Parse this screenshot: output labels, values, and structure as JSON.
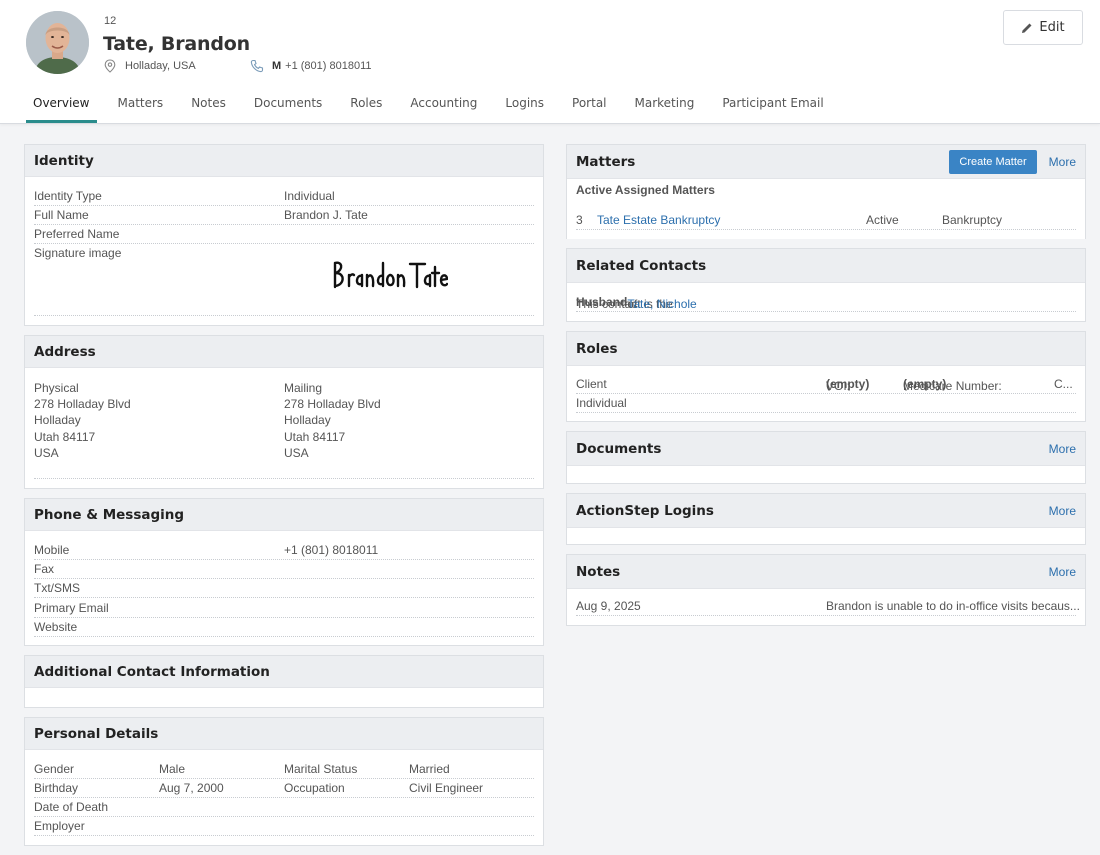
{
  "header": {
    "contact_id": "12",
    "name": "Tate, Brandon",
    "location": "Holladay, USA",
    "phone_type": "M",
    "phone": "+1 (801) 8018011",
    "edit_label": "Edit"
  },
  "tabs": [
    "Overview",
    "Matters",
    "Notes",
    "Documents",
    "Roles",
    "Accounting",
    "Logins",
    "Portal",
    "Marketing",
    "Participant Email"
  ],
  "identity": {
    "title": "Identity",
    "rows": [
      {
        "label": "Identity Type",
        "value": "Individual"
      },
      {
        "label": "Full Name",
        "value": "Brandon J. Tate"
      },
      {
        "label": "Preferred Name",
        "value": ""
      },
      {
        "label": "Signature image",
        "value": ""
      }
    ],
    "signature_text": "Brandon Tate"
  },
  "address": {
    "title": "Address",
    "physical": [
      "Physical",
      "278 Holladay Blvd",
      "Holladay",
      "Utah 84117",
      "USA"
    ],
    "mailing": [
      "Mailing",
      "278 Holladay Blvd",
      "Holladay",
      "Utah 84117",
      "USA"
    ]
  },
  "phone_messaging": {
    "title": "Phone & Messaging",
    "rows": [
      {
        "label": "Mobile",
        "value": "+1 (801) 8018011"
      },
      {
        "label": "Fax",
        "value": ""
      },
      {
        "label": "Txt/SMS",
        "value": ""
      },
      {
        "label": "Primary Email",
        "value": ""
      },
      {
        "label": "Website",
        "value": ""
      }
    ]
  },
  "additional": {
    "title": "Additional Contact Information"
  },
  "personal": {
    "title": "Personal Details",
    "rows": [
      {
        "l1": "Gender",
        "v1": "Male",
        "l2": "Marital Status",
        "v2": "Married"
      },
      {
        "l1": "Birthday",
        "v1": "Aug 7, 2000",
        "l2": "Occupation",
        "v2": "Civil Engineer"
      },
      {
        "l1": "Date of Death",
        "v1": "",
        "l2": "",
        "v2": ""
      },
      {
        "l1": "Employer",
        "v1": "",
        "l2": "",
        "v2": ""
      }
    ]
  },
  "matters": {
    "title": "Matters",
    "create_label": "Create Matter",
    "more_label": "More",
    "subheader": "Active Assigned Matters",
    "items": [
      {
        "id": "3",
        "name": "Tate Estate Bankruptcy",
        "status": "Active",
        "type": "Bankruptcy"
      }
    ]
  },
  "related": {
    "title": "Related Contacts",
    "prefix": "This contact is the",
    "relation": "Husband",
    "of": "of",
    "contact": "Tate, Nichole"
  },
  "roles": {
    "title": "Roles",
    "role": "Client",
    "voi_label": "VOI:",
    "voi_value": "(empty)",
    "medicare_label": "Medicare Number:",
    "medicare_value": "(empty)",
    "overflow": "C...",
    "sub": "Individual"
  },
  "documents": {
    "title": "Documents",
    "more_label": "More"
  },
  "logins": {
    "title": "ActionStep Logins",
    "more_label": "More"
  },
  "notes": {
    "title": "Notes",
    "more_label": "More",
    "date": "Aug 9, 2025",
    "text": "Brandon is unable to do in-office visits becaus..."
  },
  "colors": {
    "accent": "#2a8c8c",
    "link": "#2c6fad",
    "button": "#3a84c5"
  }
}
